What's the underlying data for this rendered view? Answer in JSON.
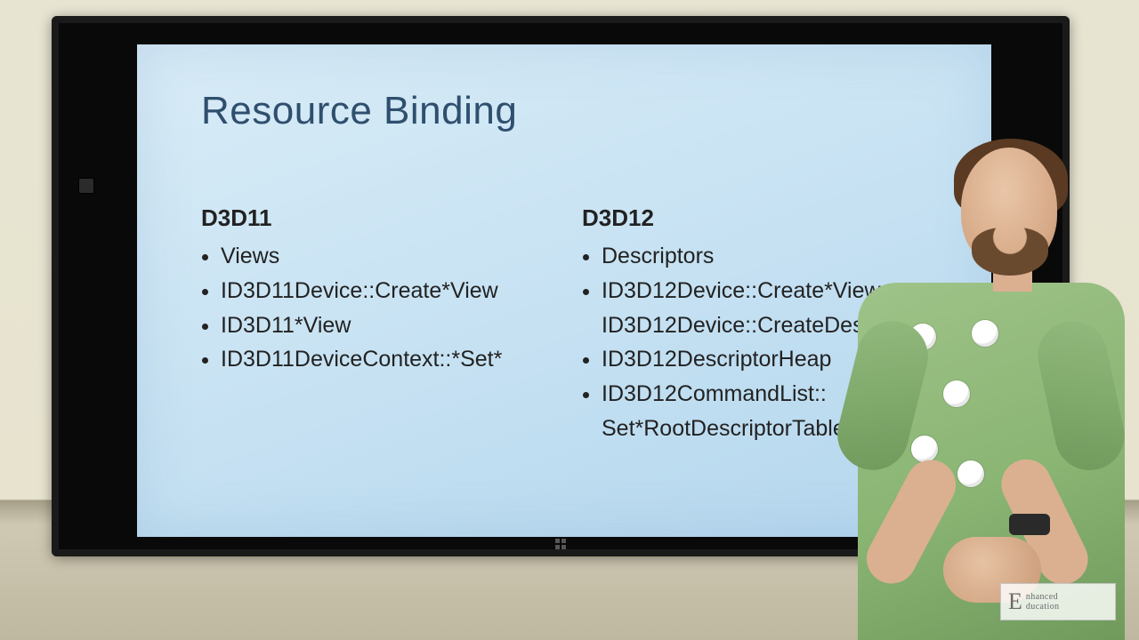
{
  "slide": {
    "title": "Resource Binding",
    "left": {
      "heading": "D3D11",
      "items": [
        "Views",
        "ID3D11Device::Create*View",
        "ID3D11*View",
        "ID3D11DeviceContext::*Set*"
      ]
    },
    "right": {
      "heading": "D3D12",
      "items": [
        "Descriptors",
        "ID3D12Device::Create*View, ID3D12Device::CreateDescriptorHeap",
        "ID3D12DescriptorHeap",
        "ID3D12CommandList:: Set*RootDescriptorTable"
      ]
    }
  },
  "watermark": {
    "big": "E",
    "line1": "nhanced",
    "line2": "ducation"
  }
}
